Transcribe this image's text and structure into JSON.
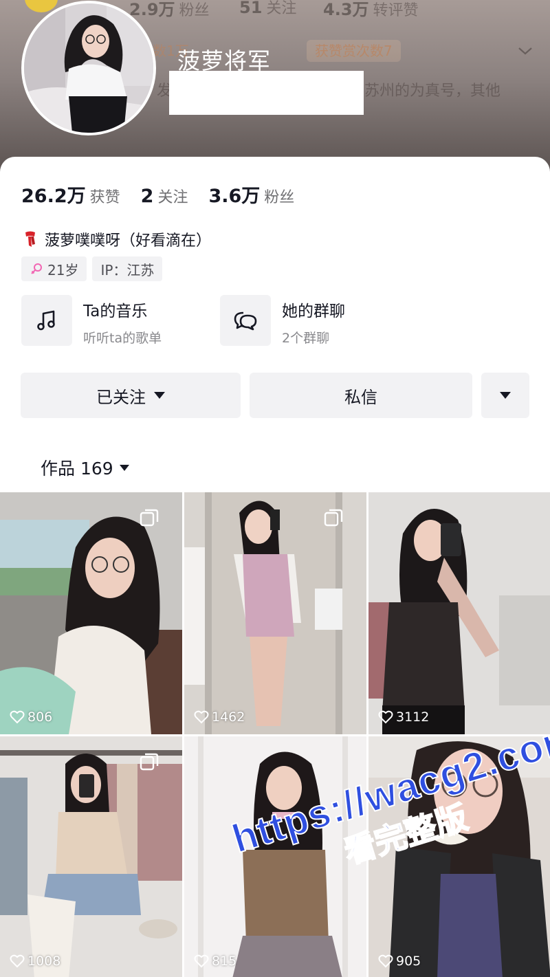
{
  "header": {
    "ghost_stats": [
      {
        "num": "2.9万",
        "label": "粉丝"
      },
      {
        "num": "51",
        "label": "关注"
      },
      {
        "num": "4.3万",
        "label": "转评赞"
      }
    ],
    "ghost_badge_left": "数1万",
    "ghost_badge_right": "获赞赏次数7",
    "ghost_bio": "苏州的为真号，其他",
    "ghost_bio_left": "发布",
    "nickname": "菠萝将军"
  },
  "stats": [
    {
      "num": "26.2万",
      "label": "获赞"
    },
    {
      "num": "2",
      "label": "关注"
    },
    {
      "num": "3.6万",
      "label": "粉丝"
    }
  ],
  "signature": "菠萝噗噗呀（好看滴在）",
  "tags": [
    {
      "icon": "female-icon",
      "label": "21岁"
    },
    {
      "icon": "",
      "label": "IP：江苏"
    }
  ],
  "entries": [
    {
      "icon": "music-note-icon",
      "title": "Ta的音乐",
      "sub": "听听ta的歌单"
    },
    {
      "icon": "group-chat-icon",
      "title": "她的群聊",
      "sub": "2个群聊"
    }
  ],
  "actions": {
    "follow_label": "已关注",
    "message_label": "私信"
  },
  "works": {
    "tab_label": "作品 169"
  },
  "grid": [
    {
      "likes": "806",
      "multi": true
    },
    {
      "likes": "1462",
      "multi": true
    },
    {
      "likes": "3112",
      "multi": false
    },
    {
      "likes": "1008",
      "multi": true
    },
    {
      "likes": "815",
      "multi": false
    },
    {
      "likes": "905",
      "multi": false
    }
  ],
  "watermark": {
    "url": "https://wacg2.com",
    "text": "看完整版"
  },
  "colors": {
    "accent_text": "#161823",
    "secondary_text": "#6f6f72",
    "chip_bg": "#f2f2f4",
    "watermark_blue": "#2f4fe0"
  }
}
